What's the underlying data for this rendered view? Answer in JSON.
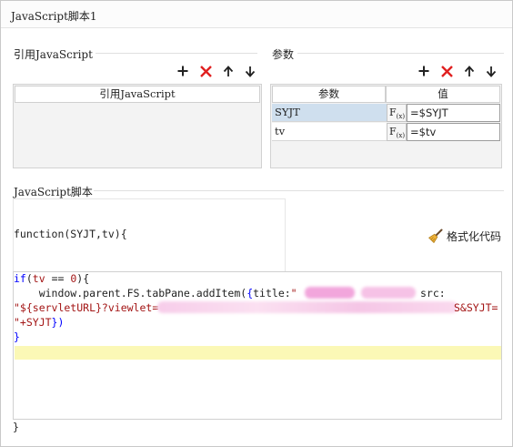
{
  "window": {
    "title": "JavaScript脚本1"
  },
  "ref_section": {
    "label": "引用JavaScript",
    "column_header": "引用JavaScript"
  },
  "params_section": {
    "label": "参数",
    "columns": [
      "参数",
      "值"
    ],
    "rows": [
      {
        "name": "SYJT",
        "fx": "F",
        "fx_sub": "(x)",
        "value": "=$SYJT",
        "selected": true
      },
      {
        "name": "tv",
        "fx": "F",
        "fx_sub": "(x)",
        "value": "=$tv",
        "selected": false
      }
    ]
  },
  "toolbar_icons": [
    "plus-icon",
    "delete-x-icon",
    "arrow-up-icon",
    "arrow-down-icon"
  ],
  "script_section": {
    "label": "JavaScript脚本",
    "function_header": "function(SYJT,tv){",
    "format_button": "格式化代码",
    "closing_brace": "}",
    "code": {
      "line1": {
        "kw": "if",
        "open": "(",
        "var": "tv",
        "op": " == ",
        "num": "0",
        "close": "){"
      },
      "line2": {
        "text": "    window.parent.FS.tabPane.addItem(",
        "brace": "{",
        "key": "title:",
        "str": "\"",
        "tail": "src:"
      },
      "line3": {
        "str_start": "\"${servletURL}?viewlet=",
        "str_end": "S&SYJT="
      },
      "line4": {
        "str": "\"+SYJT",
        "close": "})"
      },
      "line5": {
        "text": "}"
      }
    }
  },
  "colors": {
    "keyword": "#0000ff",
    "string": "#a31515",
    "variable": "#a31515",
    "delete_red": "#e02020",
    "current_line": "#fbf8b6",
    "selected_row": "#cfdfee",
    "redacted_pink": "#f0a8d8"
  }
}
